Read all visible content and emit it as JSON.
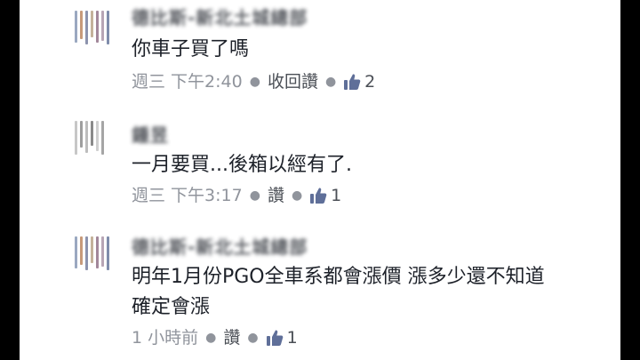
{
  "colors": {
    "text": "#1d2129",
    "meta": "#90949c",
    "action": "#4b4f56",
    "like_icon": "#5f6f99"
  },
  "comments": [
    {
      "author": "德比斯-新北土城總部",
      "text": "你車子買了嗎",
      "time": "週三 下午2:40",
      "actions": [
        "收回讚"
      ],
      "like_icon": "thumbs-up-icon",
      "like_count": "2"
    },
    {
      "author": "鍾昱",
      "text": "一月要買...後箱以經有了.",
      "time": "週三 下午3:17",
      "actions": [
        "讚"
      ],
      "like_icon": "thumbs-up-icon",
      "like_count": "1"
    },
    {
      "author": "德比斯-新北土城總部",
      "text": "明年1月份PGO全車系都會漲價 漲多少還不知道 確定會漲",
      "time": "1 小時前",
      "actions": [
        "讚"
      ],
      "like_icon": "thumbs-up-icon",
      "like_count": "1"
    }
  ]
}
